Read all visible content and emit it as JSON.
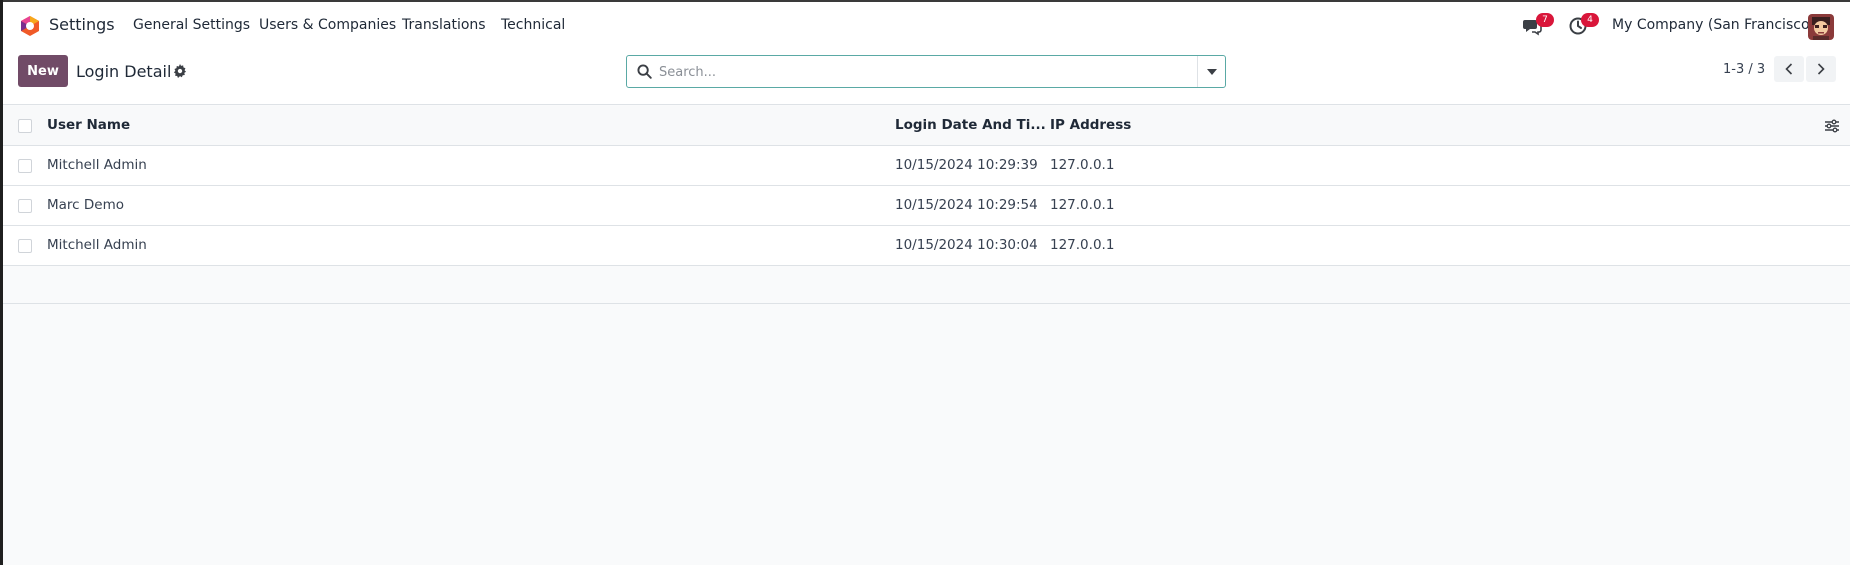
{
  "navbar": {
    "app_name": "Settings",
    "menu": [
      "General Settings",
      "Users & Companies",
      "Translations",
      "Technical"
    ],
    "messages_badge": "7",
    "activities_badge": "4",
    "company": "My Company (San Francisco)"
  },
  "control_panel": {
    "new_label": "New",
    "title": "Login Detail",
    "search_placeholder": "Search...",
    "pager": "1-3 / 3"
  },
  "table": {
    "columns": [
      "User Name",
      "Login Date And Ti...",
      "IP Address"
    ],
    "rows": [
      {
        "user": "Mitchell Admin",
        "date": "10/15/2024 10:29:39",
        "ip": "127.0.0.1"
      },
      {
        "user": "Marc Demo",
        "date": "10/15/2024 10:29:54",
        "ip": "127.0.0.1"
      },
      {
        "user": "Mitchell Admin",
        "date": "10/15/2024 10:30:04",
        "ip": "127.0.0.1"
      }
    ]
  },
  "colors": {
    "brand": "#714b67",
    "badge": "#d9163a",
    "search_border": "#5aa9a5"
  }
}
